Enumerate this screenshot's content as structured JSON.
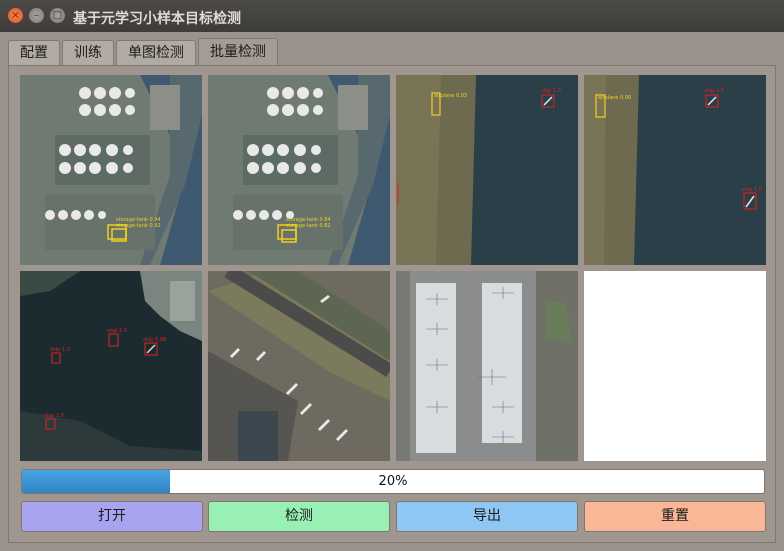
{
  "window": {
    "title": "基于元学习小样本目标检测"
  },
  "titlebar_buttons": {
    "close": "×",
    "minimize": "–",
    "maximize": "□"
  },
  "tabs": [
    {
      "label": "配置",
      "active": false
    },
    {
      "label": "训练",
      "active": false
    },
    {
      "label": "单图检测",
      "active": false
    },
    {
      "label": "批量检测",
      "active": true
    }
  ],
  "results": [
    {
      "scene": "oil-tank-farm",
      "detections": [
        "storage-tank 0.94",
        "storage-tank 0.92"
      ]
    },
    {
      "scene": "oil-tank-farm",
      "detections": [
        "storage-tank 0.84",
        "storage-tank 0.82"
      ]
    },
    {
      "scene": "airport-coast",
      "detections": [
        "airplane 0.93",
        "ship 1.0"
      ]
    },
    {
      "scene": "airport-coast",
      "detections": [
        "airplane 0.90",
        "ship 1.0",
        "ship 1.0"
      ]
    },
    {
      "scene": "harbor",
      "detections": [
        "ship 1.0",
        "ship 1.0",
        "ship 0.99",
        "ship 1.0"
      ]
    },
    {
      "scene": "airport-runway",
      "detections": []
    },
    {
      "scene": "airport-terminal",
      "detections": []
    },
    {
      "scene": "empty",
      "detections": []
    }
  ],
  "progress": {
    "value": 0.2,
    "label": "20%",
    "fill_color": "#2f86c8"
  },
  "buttons": {
    "open": "打开",
    "detect": "检测",
    "export": "导出",
    "reset": "重置"
  }
}
